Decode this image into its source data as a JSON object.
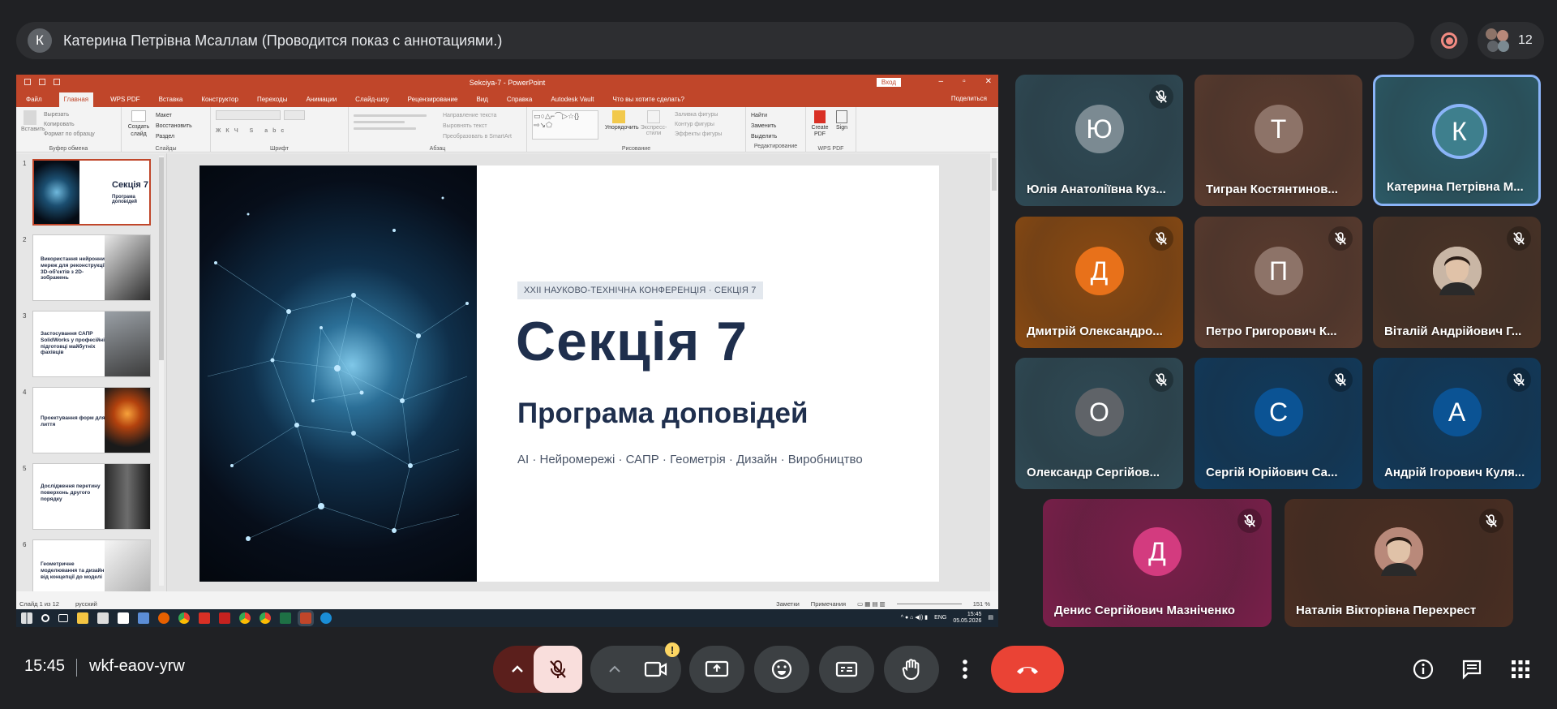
{
  "presenter_bar": {
    "avatar_letter": "К",
    "title": "Катерина Петрівна Мсаллам (Проводится показ с аннотациями.)",
    "participant_count": "12"
  },
  "powerpoint": {
    "window_title": "Sekciya-7 - PowerPoint",
    "login_label": "Вход",
    "menu_tabs": [
      "Файл",
      "Главная",
      "WPS PDF",
      "Вставка",
      "Конструктор",
      "Переходы",
      "Анимации",
      "Слайд-шоу",
      "Рецензирование",
      "Вид",
      "Справка",
      "Autodesk Vault",
      "Что вы хотите сделать?"
    ],
    "share_label": "Поделиться",
    "ribbon_groups": {
      "clipboard": "Буфер обмена",
      "slides": "Слайды",
      "font": "Шрифт",
      "paragraph": "Абзац",
      "drawing": "Рисование",
      "editing": "Редактирование",
      "wps_pdf": "WPS PDF"
    },
    "ribbon_items": {
      "paste": "Вставить",
      "cut": "Вырезать",
      "copy": "Копировать",
      "format_painter": "Формат по образцу",
      "new_slide": "Создать слайд",
      "layout": "Макет",
      "reset": "Восстановить",
      "section": "Раздел",
      "text_direction": "Направление текста",
      "align_text": "Выровнять текст",
      "smartart": "Преобразовать в SmartArt",
      "arrange": "Упорядочить",
      "quick_styles": "Экспресс-стили",
      "shape_fill": "Заливка фигуры",
      "shape_outline": "Контур фигуры",
      "shape_effects": "Эффекты фигуры",
      "find": "Найти",
      "replace": "Заменить",
      "select": "Выделить",
      "create_pdf": "Create PDF",
      "sign": "Sign"
    },
    "thumbnails": [
      {
        "num": "1",
        "title": "Секція 7",
        "subtitle": "Програма доповідей"
      },
      {
        "num": "2",
        "title": "Використання нейронних мереж для реконструкції 3D-об'єктів з 2D-зображень"
      },
      {
        "num": "3",
        "title": "Застосування САПР SolidWorks у професійній підготовці майбутніх фахівців"
      },
      {
        "num": "4",
        "title": "Проектування форм для лиття"
      },
      {
        "num": "5",
        "title": "Дослідження перетину поверхонь другого порядку"
      },
      {
        "num": "6",
        "title": "Геометричне моделювання та дизайн: від концепції до моделі"
      }
    ],
    "slide": {
      "badge": "XXII НАУКОВО-ТЕХНІЧНА КОНФЕРЕНЦІЯ · СЕКЦІЯ 7",
      "title": "Секція 7",
      "subtitle": "Програма доповідей",
      "topics": "AI · Нейромережі · САПР · Геометрія · Дизайн · Виробництво"
    },
    "status": {
      "slide_counter": "Слайд 1 из 12",
      "language": "русский",
      "notes": "Заметки",
      "comments": "Примечания",
      "zoom": "151 %"
    },
    "taskbar": {
      "lang": "ENG",
      "time": "15:45",
      "date": "05.05.2026"
    }
  },
  "participants": [
    {
      "letter": "Ю",
      "name": "Юлія Анатоліївна Куз...",
      "muted": true,
      "bg": "#2f4a55",
      "avatar_bg": "#7b8a92"
    },
    {
      "letter": "Т",
      "name": "Тигран Костянтинов...",
      "muted": false,
      "bg": "#5a3b2e",
      "avatar_bg": "#8d7368"
    },
    {
      "letter": "К",
      "name": "Катерина Петрівна М...",
      "muted": false,
      "speaking": true,
      "bg": "#2c5a66",
      "avatar_bg": "#3e7f8d"
    },
    {
      "letter": "Д",
      "name": "Дмитрій Олександро...",
      "muted": true,
      "bg": "#8a4a12",
      "avatar_bg": "#e8711a"
    },
    {
      "letter": "П",
      "name": "Петро Григорович К...",
      "muted": true,
      "bg": "#5a3b2e",
      "avatar_bg": "#8d7368"
    },
    {
      "letter": "",
      "name": "Віталій Андрійович Г...",
      "muted": true,
      "photo": true,
      "bg": "#4a3326",
      "avatar_bg": "#c9b6a5"
    },
    {
      "letter": "О",
      "name": "Олександр Сергійов...",
      "muted": true,
      "bg": "#2f4a55",
      "avatar_bg": "#5f6368"
    },
    {
      "letter": "С",
      "name": "Сергій Юрійович Са...",
      "muted": true,
      "bg": "#113a5c",
      "avatar_bg": "#0b5394"
    },
    {
      "letter": "А",
      "name": "Андрій Ігорович Куля...",
      "muted": true,
      "bg": "#113a5c",
      "avatar_bg": "#0b5394"
    },
    {
      "letter": "Д",
      "name": "Денис Сергійович Мазніченко",
      "muted": true,
      "bg": "#7a1f4a",
      "avatar_bg": "#d33b7f"
    },
    {
      "letter": "",
      "name": "Наталія Вікторівна Перехрест",
      "muted": true,
      "photo": true,
      "bg": "#4a2e22",
      "avatar_bg": "#b9897a"
    }
  ],
  "bottom_bar": {
    "time": "15:45",
    "meeting_code": "wkf-eaov-yrw",
    "warning_badge": "!"
  },
  "colors": {
    "background": "#202124",
    "end_call": "#ea4335",
    "mic_muted": "#f9dedc",
    "ppt_accent": "#c0462a",
    "speaking_border": "#8ab4f8"
  }
}
